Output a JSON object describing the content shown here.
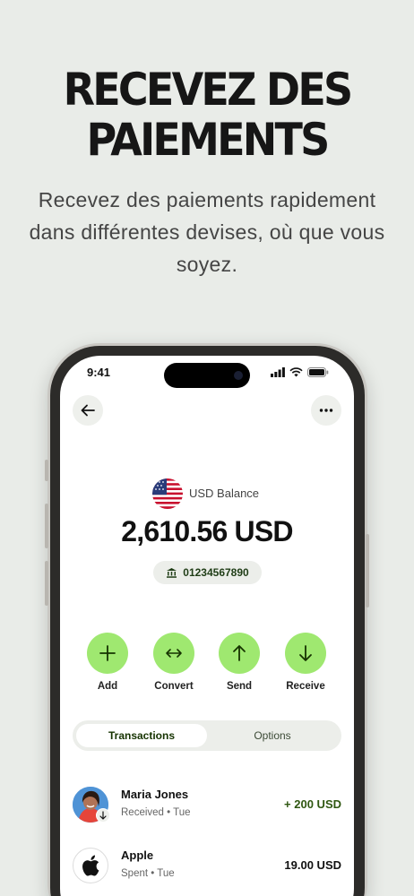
{
  "headline": {
    "line1": "RECEVEZ DES",
    "line2": "PAIEMENTS"
  },
  "subtitle": "Recevez des paiements rapidement dans différentes devises, où que vous soyez.",
  "status_bar": {
    "time": "9:41"
  },
  "balance": {
    "label": "USD Balance",
    "amount": "2,610.56 USD",
    "account_number": "01234567890"
  },
  "actions": [
    {
      "label": "Add",
      "icon": "plus-icon"
    },
    {
      "label": "Convert",
      "icon": "arrows-horizontal-icon"
    },
    {
      "label": "Send",
      "icon": "arrow-up-icon"
    },
    {
      "label": "Receive",
      "icon": "arrow-down-icon"
    }
  ],
  "tabs": [
    {
      "label": "Transactions",
      "active": true
    },
    {
      "label": "Options",
      "active": false
    }
  ],
  "transactions": [
    {
      "name": "Maria Jones",
      "subtitle": "Received • Tue",
      "amount": "+ 200 USD",
      "amount_color": "#2f5711"
    },
    {
      "name": "Apple",
      "subtitle": "Spent • Tue",
      "amount": "19.00 USD",
      "amount_color": "#111111"
    }
  ],
  "colors": {
    "accent": "#9fe870",
    "background": "#e9ece8"
  }
}
